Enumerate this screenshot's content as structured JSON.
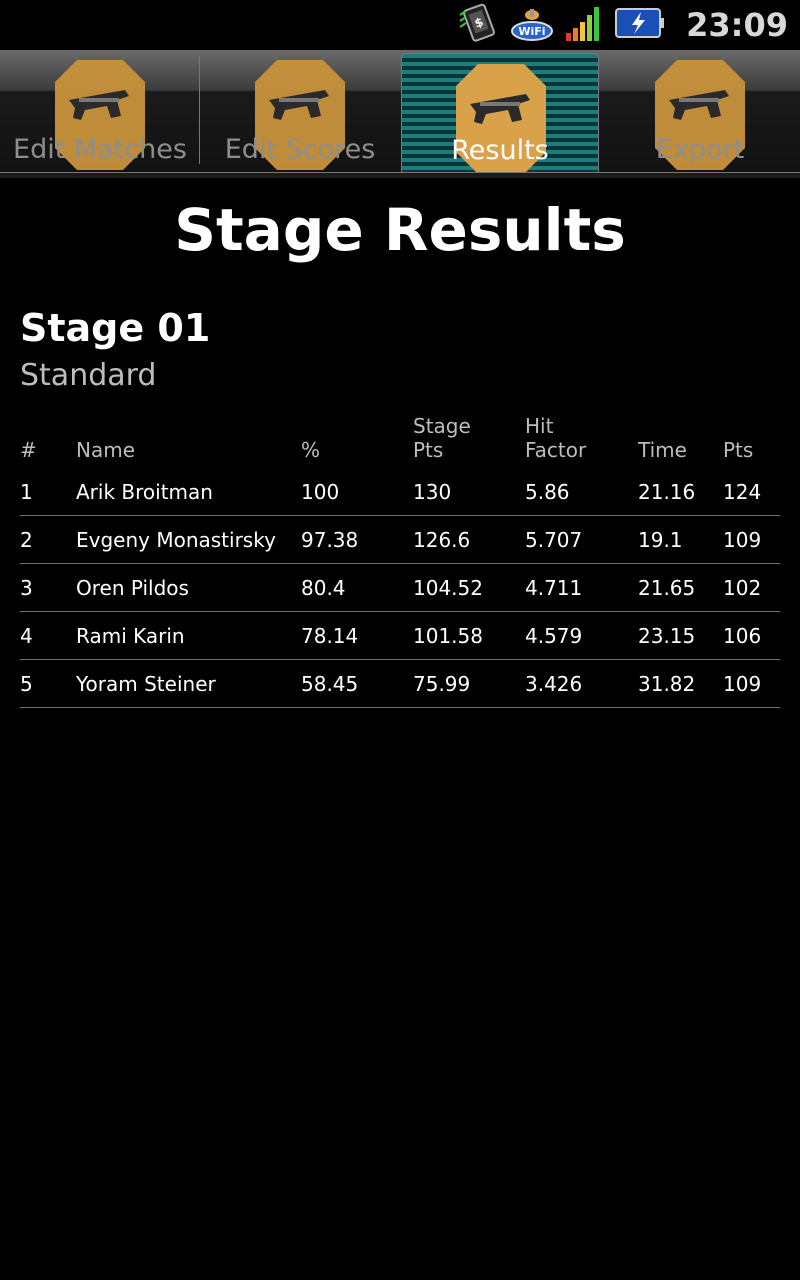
{
  "status_bar": {
    "time": "23:09",
    "icons": [
      "app-notification-icon",
      "wifi-icon",
      "signal-icon",
      "battery-charging-icon"
    ],
    "wifi_text": "Wi Fi"
  },
  "tabs": [
    {
      "label": "Edit Matches",
      "icon": "target-pistol-icon",
      "selected": false
    },
    {
      "label": "Edit Scores",
      "icon": "target-pistol-icon",
      "selected": false
    },
    {
      "label": "Results",
      "icon": "target-pistol-icon",
      "selected": true
    },
    {
      "label": "Export",
      "icon": "target-pistol-icon",
      "selected": false
    }
  ],
  "page": {
    "title": "Stage Results",
    "stage_name": "Stage 01",
    "stage_type": "Standard"
  },
  "table": {
    "headers": [
      "#",
      "Name",
      "%",
      "Stage\nPts",
      "Hit\nFactor",
      "Time",
      "Pts"
    ],
    "rows": [
      [
        "1",
        "Arik Broitman",
        "100",
        "130",
        "5.86",
        "21.16",
        "124"
      ],
      [
        "2",
        "Evgeny Monastirsky",
        "97.38",
        "126.6",
        "5.707",
        "19.1",
        "109"
      ],
      [
        "3",
        "Oren Pildos",
        "80.4",
        "104.52",
        "4.711",
        "21.65",
        "102"
      ],
      [
        "4",
        "Rami Karin",
        "78.14",
        "101.58",
        "4.579",
        "23.15",
        "106"
      ],
      [
        "5",
        "Yoram Steiner",
        "58.45",
        "75.99",
        "3.426",
        "31.82",
        "109"
      ]
    ]
  },
  "colors": {
    "background": "#000000",
    "selected_tab": "#1c7d7e",
    "target": "#c8923c",
    "muted_text": "#bdbdbd"
  }
}
